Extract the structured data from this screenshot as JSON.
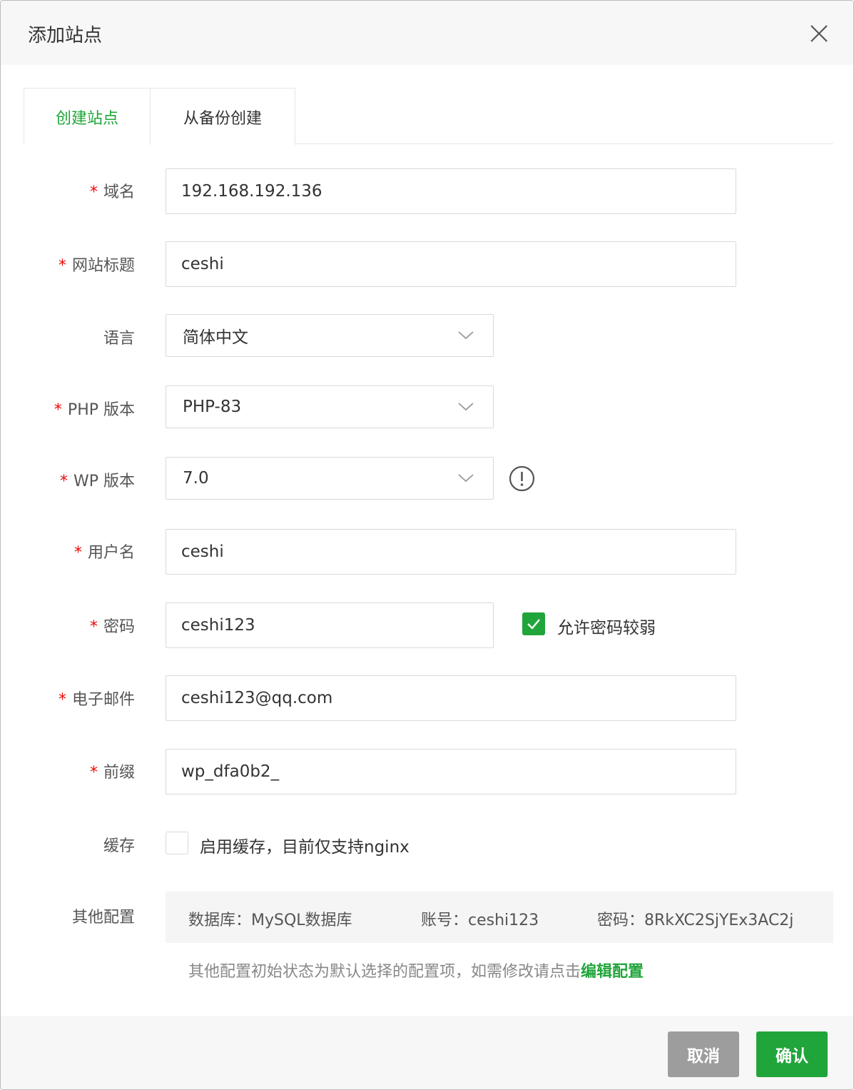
{
  "dialog": {
    "title": "添加站点"
  },
  "tabs": [
    {
      "label": "创建站点",
      "active": true
    },
    {
      "label": "从备份创建",
      "active": false
    }
  ],
  "form": {
    "domain": {
      "label": "域名",
      "value": "192.168.192.136",
      "required": "*"
    },
    "site_title": {
      "label": "网站标题",
      "value": "ceshi",
      "required": "*"
    },
    "language": {
      "label": "语言",
      "value": "简体中文"
    },
    "php_version": {
      "label": "PHP 版本",
      "value": "PHP-83",
      "required": "*"
    },
    "wp_version": {
      "label": "WP 版本",
      "value": "7.0",
      "required": "*"
    },
    "username": {
      "label": "用户名",
      "value": "ceshi",
      "required": "*"
    },
    "password": {
      "label": "密码",
      "value": "ceshi123",
      "required": "*",
      "weak_checkbox_label": "允许密码较弱",
      "weak_checked": true
    },
    "email": {
      "label": "电子邮件",
      "value": "ceshi123@qq.com",
      "required": "*"
    },
    "prefix": {
      "label": "前缀",
      "value": "wp_dfa0b2_",
      "required": "*"
    },
    "cache": {
      "label": "缓存",
      "checkbox_label": "启用缓存，目前仅支持nginx",
      "checked": false
    },
    "other": {
      "label": "其他配置",
      "database": "数据库：MySQL数据库",
      "account": "账号：ceshi123",
      "db_password": "密码：8RkXC2SjYEx3AC2j",
      "hint": "其他配置初始状态为默认选择的配置项，如需修改请点击",
      "hint_link": "编辑配置"
    }
  },
  "footer": {
    "cancel_label": "取消",
    "confirm_label": "确认"
  },
  "colors": {
    "accent": "#20a53a",
    "required": "#ef0808",
    "cancel": "#9d9d9d"
  }
}
